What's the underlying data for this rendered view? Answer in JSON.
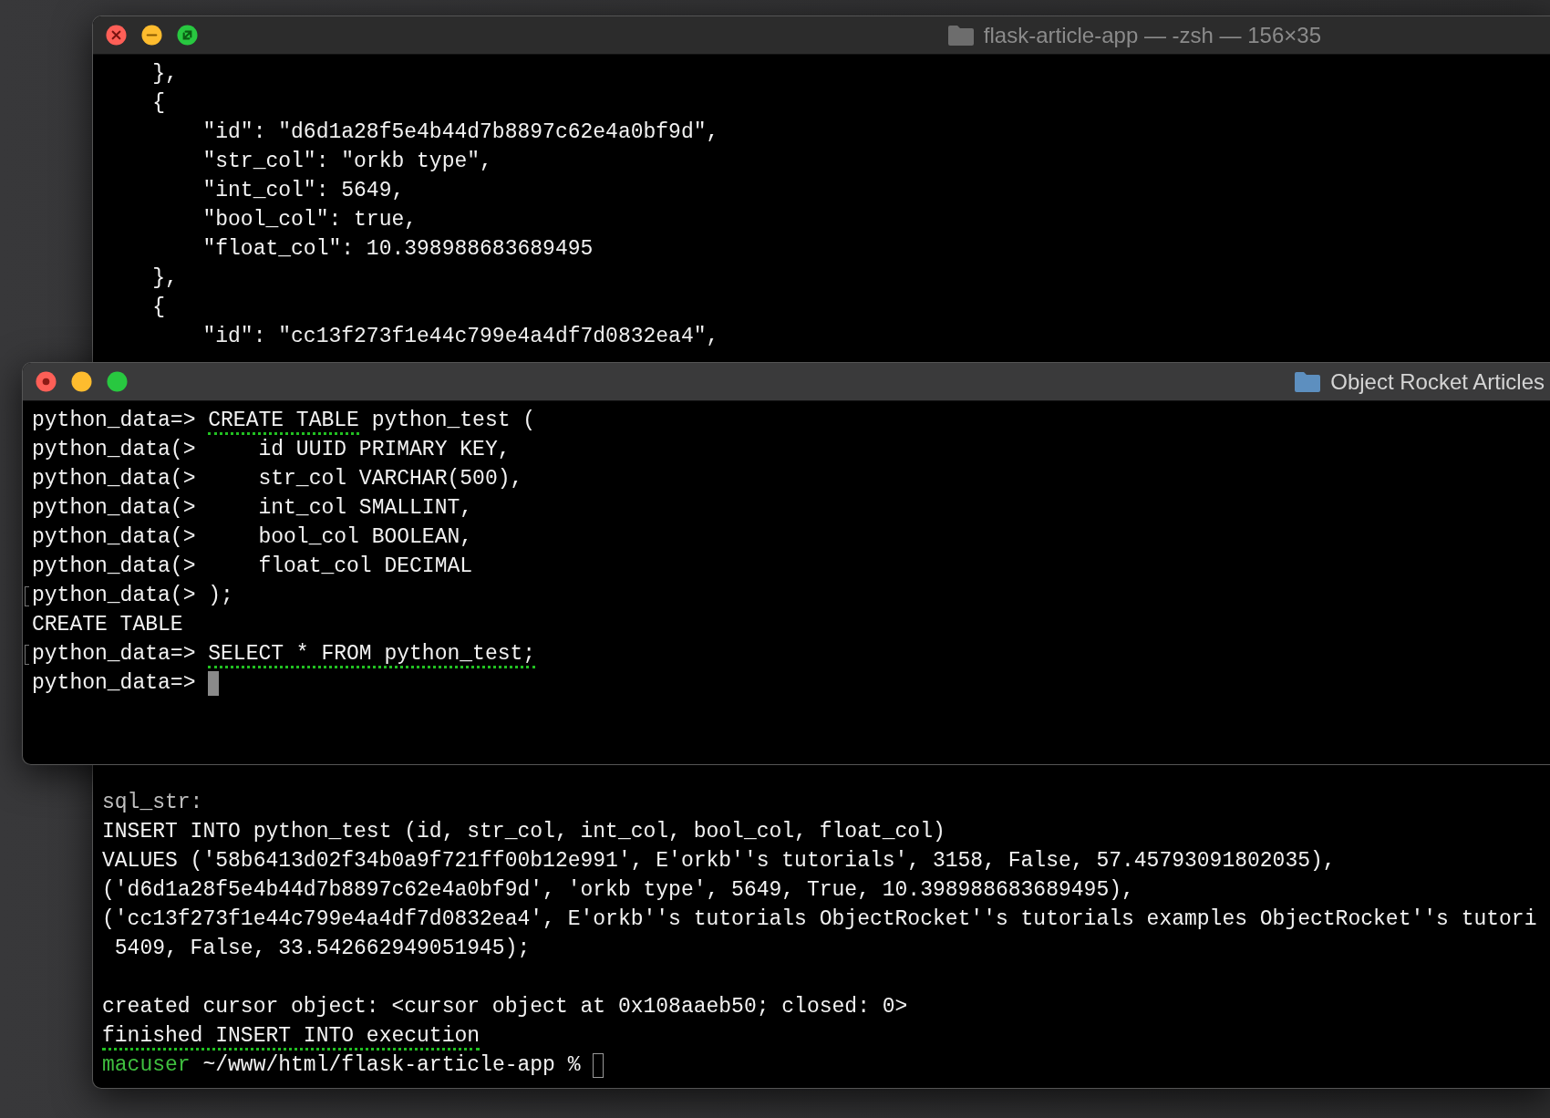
{
  "back_window": {
    "title": "flask-article-app — -zsh — 156×35",
    "active": false,
    "controls_hover": true,
    "lines_top": [
      {
        "cursor": false,
        "parts": [
          {
            "text": "    },",
            "kind": "plain"
          }
        ]
      },
      {
        "cursor": false,
        "parts": [
          {
            "text": "    {",
            "kind": "plain"
          }
        ]
      },
      {
        "cursor": false,
        "parts": [
          {
            "text": "        \"id\": \"d6d1a28f5e4b44d7b8897c62e4a0bf9d\",",
            "kind": "plain"
          }
        ]
      },
      {
        "cursor": false,
        "parts": [
          {
            "text": "        \"str_col\": \"orkb type\",",
            "kind": "plain"
          }
        ]
      },
      {
        "cursor": false,
        "parts": [
          {
            "text": "        \"int_col\": 5649,",
            "kind": "plain"
          }
        ]
      },
      {
        "cursor": false,
        "parts": [
          {
            "text": "        \"bool_col\": true,",
            "kind": "plain"
          }
        ]
      },
      {
        "cursor": false,
        "parts": [
          {
            "text": "        \"float_col\": 10.398988683689495",
            "kind": "plain"
          }
        ]
      },
      {
        "cursor": false,
        "parts": [
          {
            "text": "    },",
            "kind": "plain"
          }
        ]
      },
      {
        "cursor": false,
        "parts": [
          {
            "text": "    {",
            "kind": "plain"
          }
        ]
      },
      {
        "cursor": false,
        "parts": [
          {
            "text": "        \"id\": \"cc13f273f1e44c799e4a4df7d0832ea4\",",
            "kind": "plain"
          }
        ]
      }
    ],
    "blocks_bottom": [
      {
        "lines": [
          {
            "cursor": false,
            "parts": [
              {
                "text": "sql_str:",
                "kind": "dim"
              }
            ]
          },
          {
            "cursor": false,
            "parts": [
              {
                "text": "INSERT INTO python_test (id, str_col, int_col, bool_col, float_col)",
                "kind": "plain"
              }
            ]
          },
          {
            "cursor": false,
            "parts": [
              {
                "text": "VALUES ('58b6413d02f34b0a9f721ff00b12e991', E'orkb''s tutorials', 3158, False, 57.45793091802035),",
                "kind": "plain"
              }
            ]
          },
          {
            "cursor": false,
            "parts": [
              {
                "text": "('d6d1a28f5e4b44d7b8897c62e4a0bf9d', 'orkb type', 5649, True, 10.398988683689495),",
                "kind": "plain"
              }
            ]
          },
          {
            "cursor": false,
            "parts": [
              {
                "text": "('cc13f273f1e44c799e4a4df7d0832ea4', E'orkb''s tutorials ObjectRocket''s tutorials examples ObjectRocket''s tutori",
                "kind": "plain"
              }
            ]
          },
          {
            "cursor": false,
            "parts": [
              {
                "text": " 5409, False, 33.542662949051945);",
                "kind": "plain"
              }
            ]
          }
        ]
      },
      {
        "lines": [
          {
            "cursor": false,
            "parts": [
              {
                "text": "created cursor object: <cursor object at 0x108aaeb50; closed: 0>",
                "kind": "plain"
              }
            ]
          },
          {
            "cursor": false,
            "parts": [
              {
                "text": "finished INSERT INTO execution",
                "kind": "underlined"
              }
            ]
          },
          {
            "cursor": true,
            "parts": [
              {
                "text": "macuser",
                "kind": "user"
              },
              {
                "text": " ~/www/html/flask-article-app % ",
                "kind": "plain"
              }
            ]
          }
        ]
      }
    ]
  },
  "front_window": {
    "title": "Object Rocket Articles",
    "active": true,
    "controls_hover": false,
    "lines": [
      {
        "marked": false,
        "cursor": false,
        "parts": [
          {
            "text": "python_data=> ",
            "kind": "plain"
          },
          {
            "text": "CREATE TABLE",
            "kind": "underlined"
          },
          {
            "text": " python_test (",
            "kind": "plain"
          }
        ]
      },
      {
        "marked": false,
        "cursor": false,
        "parts": [
          {
            "text": "python_data(>     id UUID PRIMARY KEY,",
            "kind": "plain"
          }
        ]
      },
      {
        "marked": false,
        "cursor": false,
        "parts": [
          {
            "text": "python_data(>     str_col VARCHAR(500),",
            "kind": "plain"
          }
        ]
      },
      {
        "marked": false,
        "cursor": false,
        "parts": [
          {
            "text": "python_data(>     int_col SMALLINT,",
            "kind": "plain"
          }
        ]
      },
      {
        "marked": false,
        "cursor": false,
        "parts": [
          {
            "text": "python_data(>     bool_col BOOLEAN,",
            "kind": "plain"
          }
        ]
      },
      {
        "marked": false,
        "cursor": false,
        "parts": [
          {
            "text": "python_data(>     float_col DECIMAL",
            "kind": "plain"
          }
        ]
      },
      {
        "marked": true,
        "cursor": false,
        "parts": [
          {
            "text": "python_data(> );",
            "kind": "plain"
          }
        ]
      },
      {
        "marked": false,
        "cursor": false,
        "parts": [
          {
            "text": "CREATE TABLE",
            "kind": "plain"
          }
        ]
      },
      {
        "marked": true,
        "cursor": false,
        "parts": [
          {
            "text": "python_data=> ",
            "kind": "plain"
          },
          {
            "text": "SELECT * FROM python_test;",
            "kind": "underlined"
          }
        ]
      },
      {
        "marked": false,
        "cursor": true,
        "parts": [
          {
            "text": "python_data=> ",
            "kind": "plain"
          }
        ]
      }
    ]
  }
}
